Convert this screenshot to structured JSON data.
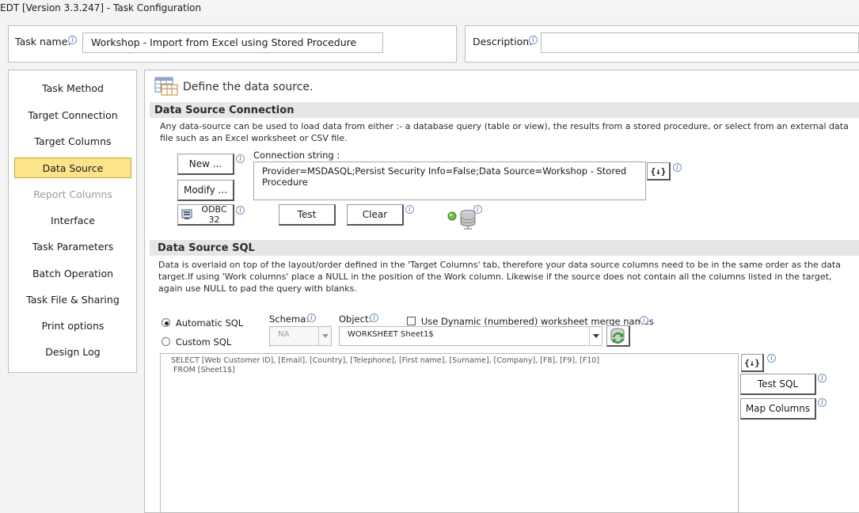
{
  "window": {
    "title": "EDT [Version 3.3.247] - Task Configuration"
  },
  "task": {
    "name_label": "Task name:",
    "name_value": "Workshop - Import from Excel using Stored Procedure",
    "description_label": "Description:",
    "description_value": ""
  },
  "sidebar": {
    "items": [
      {
        "label": "Task Method"
      },
      {
        "label": "Target Connection"
      },
      {
        "label": "Target Columns"
      },
      {
        "label": "Data Source"
      },
      {
        "label": "Report Columns"
      },
      {
        "label": "Interface"
      },
      {
        "label": "Task Parameters"
      },
      {
        "label": "Batch Operation"
      },
      {
        "label": "Task File & Sharing"
      },
      {
        "label": "Print options"
      },
      {
        "label": "Design Log"
      }
    ],
    "active": "Data Source",
    "disabled": "Report Columns"
  },
  "page": {
    "heading": "Define the data source."
  },
  "connection": {
    "section_title": "Data Source Connection",
    "description": "Any data-source can be used to load data from either :- a database query (table or view), the results from a stored procedure, or select from an external data file such as an Excel worksheet or CSV file.",
    "new_label": "New ...",
    "modify_label": "Modify ...",
    "odbc_label": "ODBC 32",
    "conn_string_label": "Connection string :",
    "conn_string_value": "Provider=MSDASQL;Persist Security Info=False;Data Source=Workshop - Stored Procedure",
    "test_label": "Test",
    "clear_label": "Clear",
    "var_label": "{↓}"
  },
  "sql": {
    "section_title": "Data Source SQL",
    "description": "Data is overlaid on top of the layout/order defined in the 'Target Columns' tab,  therefore your data source columns need to be in the same order as the data target.If using 'Work columns' place a NULL in the position of the Work column.  Likewise if the source does not contain all the columns listed in the target, again use NULL to pad the query with blanks.",
    "automatic_label": "Automatic SQL",
    "custom_label": "Custom SQL",
    "mode": "automatic",
    "schema_label": "Schema:",
    "schema_value": "NA",
    "object_label": "Object:",
    "object_value": "WORKSHEET Sheet1$",
    "dynamic_label": "Use Dynamic (numbered) worksheet merge names",
    "dynamic_checked": false,
    "query": " SELECT [Web Customer ID], [Email], [Country], [Telephone], [First name], [Surname], [Company], [F8], [F9], [F10]\n  FROM [Sheet1$]",
    "var_label": "{↓}",
    "test_sql_label": "Test SQL",
    "map_columns_label": "Map Columns"
  }
}
